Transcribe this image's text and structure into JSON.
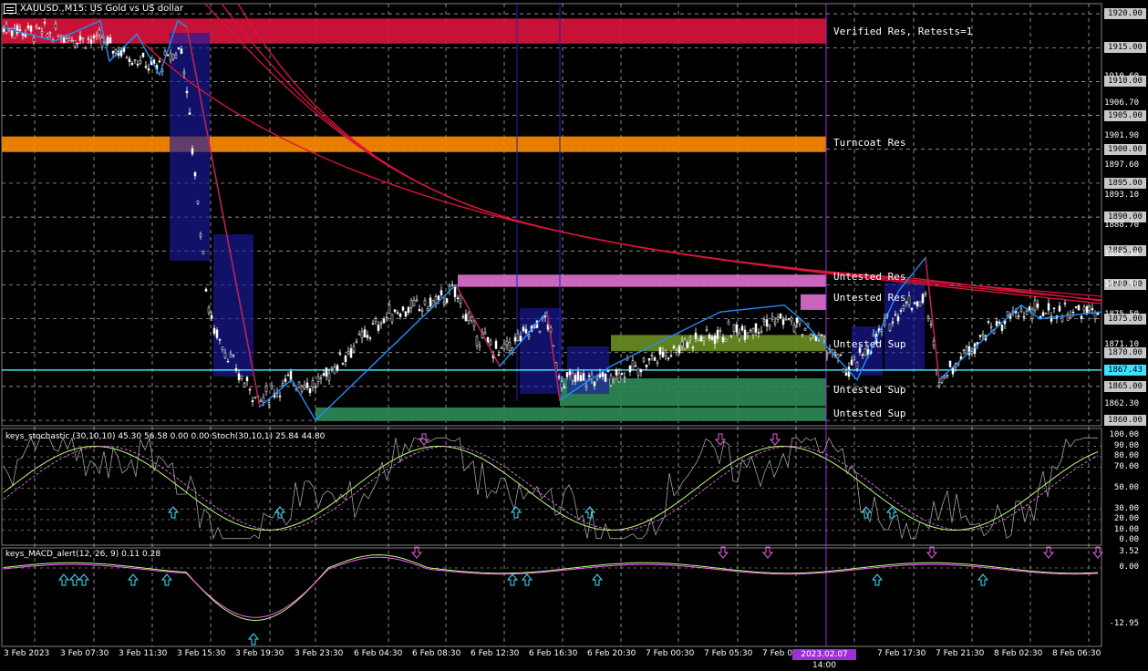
{
  "title": "XAUUSD.,M15: US Gold vs US dollar",
  "price_axis": {
    "main": [
      {
        "v": 1920,
        "t": "1920.00",
        "tag": true
      },
      {
        "v": 1915,
        "t": "1915.00",
        "tag": true
      },
      {
        "v": 1910.6,
        "t": "1910.60",
        "tag": false
      },
      {
        "v": 1910,
        "t": "1910.00",
        "tag": true
      },
      {
        "v": 1906.7,
        "t": "1906.70",
        "tag": false
      },
      {
        "v": 1905,
        "t": "1905.00",
        "tag": true
      },
      {
        "v": 1901.9,
        "t": "1901.90",
        "tag": false
      },
      {
        "v": 1900,
        "t": "1900.00",
        "tag": true
      },
      {
        "v": 1897.6,
        "t": "1897.60",
        "tag": false
      },
      {
        "v": 1895,
        "t": "1895.00",
        "tag": true
      },
      {
        "v": 1893.1,
        "t": "1893.10",
        "tag": false
      },
      {
        "v": 1890,
        "t": "1890.00",
        "tag": true
      },
      {
        "v": 1888.7,
        "t": "1888.70",
        "tag": false
      },
      {
        "v": 1885,
        "t": "1885.00",
        "tag": true
      },
      {
        "v": 1884.3,
        "t": "1884.30",
        "tag": false
      },
      {
        "v": 1880,
        "t": "1880.00",
        "tag": true
      },
      {
        "v": 1879.9,
        "t": "1879.90",
        "tag": false
      },
      {
        "v": 1875.5,
        "t": "1875.50",
        "tag": false
      },
      {
        "v": 1875,
        "t": "1875.00",
        "tag": true
      },
      {
        "v": 1871.1,
        "t": "1871.10",
        "tag": false
      },
      {
        "v": 1870,
        "t": "1870.00",
        "tag": true
      },
      {
        "v": 1866.7,
        "t": "1866.70",
        "tag": false
      },
      {
        "v": 1865,
        "t": "1865.00",
        "tag": true
      },
      {
        "v": 1862.3,
        "t": "1862.30",
        "tag": false
      },
      {
        "v": 1860,
        "t": "1860.00",
        "tag": true
      }
    ],
    "current_price": "1867.43",
    "stoch": [
      "100.00",
      "90.00",
      "80.00",
      "70.00",
      "50.00",
      "30.00",
      "20.00",
      "10.00",
      "0.00"
    ],
    "macd": [
      "3.52",
      "0.00",
      "-12.95"
    ]
  },
  "zones": [
    {
      "label": "Verified Res, Retests=1",
      "color": "#dc143c"
    },
    {
      "label": "Turncoat Res",
      "color": "#ff8c00"
    },
    {
      "label": "Untested Res",
      "color": "#e070d0"
    },
    {
      "label": "Untested Res",
      "color": "#e070d0"
    },
    {
      "label": "Untested Sup",
      "color": "#6b8e23"
    },
    {
      "label": "Untested Sup",
      "color": "#2e8b57"
    },
    {
      "label": "Untested Sup",
      "color": "#2e8b57"
    }
  ],
  "indicators": {
    "stoch_label": "keys_stochastic (30,10,10) 45.30 56.58 0.00 0.00 Stoch(30,10,1) 25.84 44.80",
    "macd_label": "keys_MACD_alert(12, 26, 9) 0.11 0.28"
  },
  "time_axis": [
    "3 Feb 2023",
    "3 Feb 07:30",
    "3 Feb 11:30",
    "3 Feb 15:30",
    "3 Feb 19:30",
    "3 Feb 23:30",
    "6 Feb 04:30",
    "6 Feb 08:30",
    "6 Feb 12:30",
    "6 Feb 16:30",
    "6 Feb 20:30",
    "7 Feb 00:30",
    "7 Feb 05:30",
    "7 Feb 0",
    "7 Feb 17:30",
    "7 Feb 21:30",
    "8 Feb 02:30",
    "8 Feb 06:30"
  ],
  "cursor_time": "2023.02.07 14:00",
  "colors": {
    "bull": "#00d000",
    "candle": "#ffffff",
    "grid": "#c0c0c0",
    "zigzag": "#1e90ff",
    "ma": "#dc143c",
    "hline": "#40e0ff",
    "vline": "#9b30d9"
  }
}
